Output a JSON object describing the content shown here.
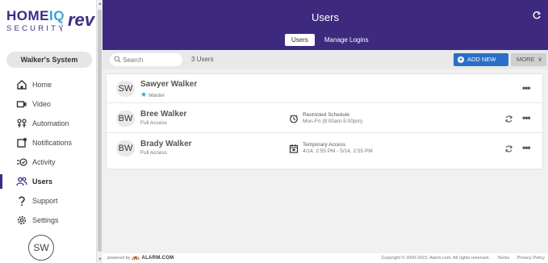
{
  "logo": {
    "home": "HOME",
    "iq": "IQ",
    "security": "SECURITY",
    "rev": "rev"
  },
  "system_name": "Walker's System",
  "nav": [
    {
      "label": "Home",
      "icon": "home-icon"
    },
    {
      "label": "Video",
      "icon": "video-icon"
    },
    {
      "label": "Automation",
      "icon": "automation-icon"
    },
    {
      "label": "Notifications",
      "icon": "notifications-icon"
    },
    {
      "label": "Activity",
      "icon": "activity-icon"
    },
    {
      "label": "Users",
      "icon": "users-icon",
      "active": true
    },
    {
      "label": "Support",
      "icon": "support-icon"
    },
    {
      "label": "Settings",
      "icon": "settings-icon"
    }
  ],
  "user_avatar": "SW",
  "header": {
    "title": "Users",
    "tabs": [
      {
        "label": "Users",
        "active": true
      },
      {
        "label": "Manage Logins"
      }
    ]
  },
  "toolbar": {
    "search_placeholder": "Search",
    "count": "3 Users",
    "add_label": "ADD NEW USER",
    "more_label": "MORE"
  },
  "users": [
    {
      "initials": "SW",
      "name": "Sawyer Walker",
      "role": "Master",
      "star": "★",
      "schedule_title": "",
      "schedule_detail": "",
      "sync": false
    },
    {
      "initials": "BW",
      "name": "Bree Walker",
      "role": "Full Access",
      "schedule_title": "Restricted Schedule",
      "schedule_detail": "Mon-Fri (8:00am-5:00pm)",
      "schedule_icon": "restricted-schedule-icon",
      "sync": true
    },
    {
      "initials": "BW",
      "name": "Brady Walker",
      "role": "Full Access",
      "schedule_title": "Temporary Access",
      "schedule_detail": "4/14, 2:55 PM - 5/14, 2:55 PM",
      "schedule_icon": "calendar-icon",
      "sync": true
    }
  ],
  "footer": {
    "powered_by": "powered by",
    "alarm": "ALARM.COM",
    "copyright": "Copyright © 2000-2022. Alarm.com. All rights reserved.",
    "terms": "Terms",
    "privacy": "Privacy Policy"
  },
  "colors": {
    "brand_purple": "#3d2a7f",
    "accent_blue": "#2a6fc6",
    "star_blue": "#2f9fd8"
  }
}
